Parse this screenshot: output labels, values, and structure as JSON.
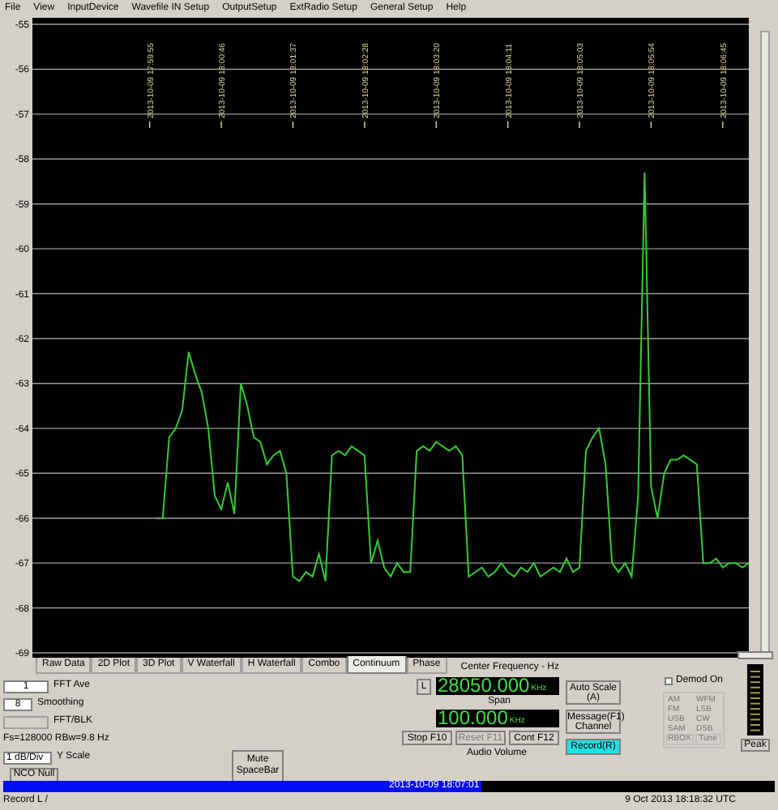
{
  "menu": [
    {
      "label": "File"
    },
    {
      "label": "View"
    },
    {
      "label": "InputDevice"
    },
    {
      "label": "Wavefile IN Setup"
    },
    {
      "label": "OutputSetup"
    },
    {
      "label": "ExtRadio Setup"
    },
    {
      "label": "General Setup"
    },
    {
      "label": "Help"
    }
  ],
  "chart": {
    "chart_data": {
      "type": "line",
      "grid": true,
      "categories": [
        null,
        null,
        null,
        null,
        null,
        null,
        null,
        null,
        null,
        null,
        null,
        null,
        null,
        null,
        null,
        null,
        null,
        null,
        "2013-10-09 17:59:55",
        null,
        null,
        null,
        null,
        null,
        null,
        null,
        null,
        null,
        null,
        "2013-10-09 18:00:46",
        null,
        null,
        null,
        null,
        null,
        null,
        null,
        null,
        null,
        null,
        "2013-10-09 18:01:37",
        null,
        null,
        null,
        null,
        null,
        null,
        null,
        null,
        null,
        null,
        "2013-10-09 18:02:28",
        null,
        null,
        null,
        null,
        null,
        null,
        null,
        null,
        null,
        null,
        "2013-10-09 18:03:20",
        null,
        null,
        null,
        null,
        null,
        null,
        null,
        null,
        null,
        null,
        "2013-10-09 18:04:11",
        null,
        null,
        null,
        null,
        null,
        null,
        null,
        null,
        null,
        null,
        "2013-10-09 18:05:03",
        null,
        null,
        null,
        null,
        null,
        null,
        null,
        null,
        null,
        null,
        "2013-10-09 18:05:54",
        null,
        null,
        null,
        null,
        null,
        null,
        null,
        null,
        null,
        null,
        "2013-10-09 18:06:45",
        null,
        null,
        null,
        null
      ],
      "ylim": [
        -69,
        -55
      ],
      "yticks": [
        -55,
        -56,
        -57,
        -58,
        -59,
        -60,
        -61,
        -62,
        -63,
        -64,
        -65,
        -66,
        -67,
        -68,
        -69
      ],
      "series": [
        {
          "color": "#33cc33",
          "values": [
            null,
            null,
            null,
            null,
            null,
            null,
            null,
            null,
            null,
            null,
            null,
            null,
            null,
            null,
            null,
            null,
            null,
            null,
            null,
            -66.0,
            -66.0,
            -64.2,
            -64.0,
            -63.6,
            -62.3,
            -62.8,
            -63.2,
            -64.0,
            -65.5,
            -65.8,
            -65.2,
            -65.9,
            -63.0,
            -63.5,
            -64.2,
            -64.3,
            -64.8,
            -64.6,
            -64.5,
            -65.0,
            -67.3,
            -67.4,
            -67.2,
            -67.3,
            -66.8,
            -67.4,
            -64.6,
            -64.5,
            -64.6,
            -64.4,
            -64.5,
            -64.6,
            -67.0,
            -66.5,
            -67.1,
            -67.3,
            -67.0,
            -67.2,
            -67.2,
            -64.5,
            -64.4,
            -64.5,
            -64.3,
            -64.4,
            -64.5,
            -64.4,
            -64.6,
            -67.3,
            -67.2,
            -67.1,
            -67.3,
            -67.2,
            -67.0,
            -67.2,
            -67.3,
            -67.1,
            -67.2,
            -67.0,
            -67.3,
            -67.2,
            -67.1,
            -67.2,
            -66.9,
            -67.2,
            -67.1,
            -64.5,
            -64.2,
            -64.0,
            -64.8,
            -67.0,
            -67.2,
            -67.0,
            -67.3,
            -65.5,
            -58.3,
            -65.3,
            -66.0,
            -65.0,
            -64.7,
            -64.7,
            -64.6,
            -64.7,
            -64.8,
            -67.0,
            -67.0,
            -66.9,
            -67.1,
            -67.0,
            -67.0,
            -67.1,
            -67.0
          ]
        }
      ]
    }
  },
  "tabs": [
    {
      "label": "Raw Data",
      "selected": false
    },
    {
      "label": "2D Plot",
      "selected": false
    },
    {
      "label": "3D Plot",
      "selected": false
    },
    {
      "label": "V Waterfall",
      "selected": false
    },
    {
      "label": "H Waterfall",
      "selected": false
    },
    {
      "label": "Combo",
      "selected": false
    },
    {
      "label": "Continuum",
      "selected": true
    },
    {
      "label": "Phase",
      "selected": false
    }
  ],
  "fft_ave": {
    "value": "1",
    "label": "FFT Ave"
  },
  "smoothing": {
    "value": "8",
    "label": "Smoothing"
  },
  "fft_blk": {
    "label": "FFT/BLK"
  },
  "rate_info": "Fs=128000 RBw=9.8 Hz",
  "y_scale": {
    "value": "1 dB/Div",
    "label": "Y Scale"
  },
  "nco_null": "NCO Null",
  "mute_button": "Mute SpaceBar",
  "center_frequency": {
    "label": "Center Frequency - Hz",
    "l_button": "L",
    "value": "28050.000",
    "unit": "KHz"
  },
  "span": {
    "label": "Span",
    "value": "100.000",
    "unit": "KHz"
  },
  "buttons": [
    {
      "label": "Auto Scale (A)",
      "disabled": false,
      "on": false
    },
    {
      "label": "Message(F1) Channel",
      "disabled": false,
      "on": false
    },
    {
      "label": "Stop F10",
      "disabled": false,
      "on": false
    },
    {
      "label": "Reset F11",
      "disabled": true,
      "on": false
    },
    {
      "label": "Cont F12",
      "disabled": false,
      "on": false
    },
    {
      "label": "Record(R)",
      "disabled": false,
      "on": true
    }
  ],
  "audio_volume": "Audio Volume",
  "demod": {
    "label": "Demod On",
    "checked": false,
    "modes": [
      {
        "label": "AM"
      },
      {
        "label": "WFM"
      },
      {
        "label": "FM"
      },
      {
        "label": "LSB"
      },
      {
        "label": "USB"
      },
      {
        "label": "CW"
      },
      {
        "label": "SAM"
      },
      {
        "label": "DSB"
      }
    ],
    "buttons": [
      "RBOX",
      "Tune"
    ]
  },
  "peak_button": "Peak",
  "progress": {
    "level": 0.62,
    "text": "2013-10-09 18:07:01"
  },
  "status_bar": {
    "left": "Record L /",
    "right": "9 Oct 2013  18:18:32 UTC"
  }
}
